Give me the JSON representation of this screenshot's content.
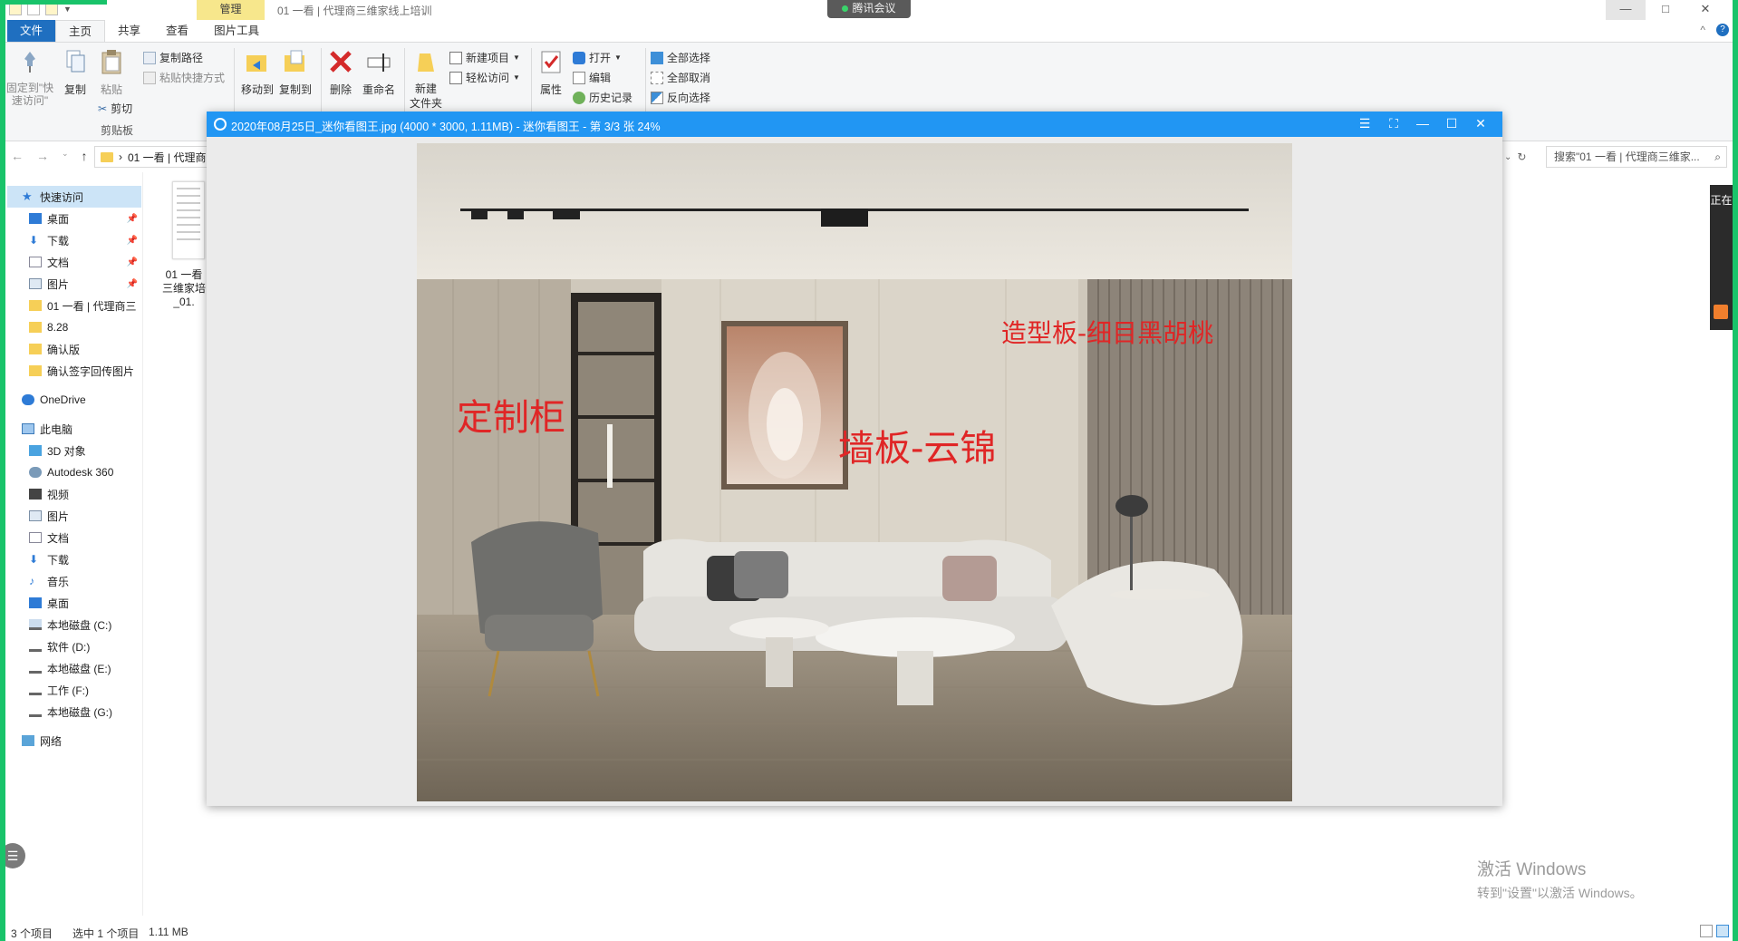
{
  "titlebar": {
    "manage_tab": "管理",
    "title": "01 一看 | 代理商三维家线上培训",
    "tencent_meeting": "腾讯会议",
    "min": "—",
    "max": "□",
    "close": "✕"
  },
  "ribbon_tabs": {
    "file": "文件",
    "home": "主页",
    "share": "共享",
    "view": "查看",
    "picture_tools": "图片工具"
  },
  "ribbon": {
    "pin_quick_access": "固定到\"快速访问\"",
    "copy": "复制",
    "paste": "粘贴",
    "copy_path": "复制路径",
    "paste_shortcut": "粘贴快捷方式",
    "cut": "剪切",
    "clipboard_group": "剪贴板",
    "move_to": "移动到",
    "copy_to": "复制到",
    "delete": "删除",
    "rename": "重命名",
    "new_folder": "新建\n文件夹",
    "new_item": "新建项目",
    "easy_access": "轻松访问",
    "properties": "属性",
    "open": "打开",
    "edit": "编辑",
    "history": "历史记录",
    "select_all": "全部选择",
    "select_none": "全部取消",
    "invert_selection": "反向选择"
  },
  "address": {
    "path_segment": "01 一看 | 代理商",
    "search_placeholder": "搜索\"01 一看 | 代理商三维家...",
    "refresh": "↻"
  },
  "nav": {
    "quick_access": "快速访问",
    "desktop_pinned": "桌面",
    "downloads_pinned": "下载",
    "documents_pinned": "文档",
    "pictures_pinned": "图片",
    "folder_01": "01 一看 | 代理商三",
    "folder_828": "8.28",
    "folder_confirm": "确认版",
    "folder_sign": "确认签字回传图片",
    "onedrive": "OneDrive",
    "this_pc": "此电脑",
    "objects_3d": "3D 对象",
    "autodesk": "Autodesk 360",
    "videos": "视频",
    "pictures": "图片",
    "documents": "文档",
    "downloads": "下载",
    "music": "音乐",
    "desktop": "桌面",
    "drive_c": "本地磁盘 (C:)",
    "drive_d": "软件 (D:)",
    "drive_e": "本地磁盘 (E:)",
    "drive_f": "工作 (F:)",
    "drive_g": "本地磁盘 (G:)",
    "network": "网络"
  },
  "file_item": {
    "label": "01 一看 三维家培 _01."
  },
  "statusbar": {
    "item_count": "3 个项目",
    "selected": "选中 1 个项目",
    "size": "1.11 MB"
  },
  "viewer": {
    "title": "2020年08月25日_迷你看图王.jpg (4000 * 3000, 1.11MB) - 迷你看图王 - 第 3/3 张 24%",
    "menu": "☰",
    "fullscreen": "⛶",
    "minimize": "—",
    "maximize": "☐",
    "close": "✕",
    "annotation_cabinet": "定制柜",
    "annotation_wall": "墙板-云锦",
    "annotation_panel": "造型板-细目黑胡桃"
  },
  "watermark": {
    "line1": "激活 Windows",
    "line2": "转到\"设置\"以激活 Windows。"
  },
  "right_tab": {
    "label": "正在"
  },
  "colors": {
    "accent_blue": "#2196f3",
    "file_tab_blue": "#1f6fc0",
    "manage_yellow": "#f7e78c",
    "annotation_red": "#e02626",
    "share_green": "#19c36a"
  }
}
